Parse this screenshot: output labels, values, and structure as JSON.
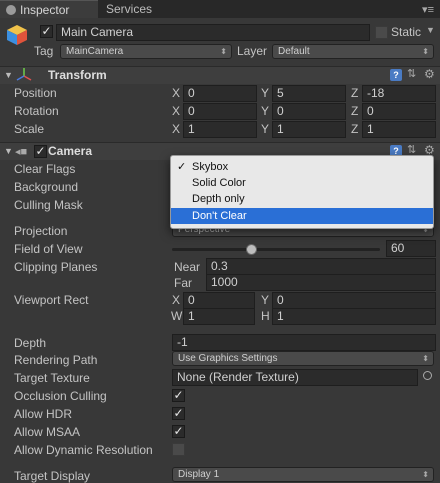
{
  "tabs": [
    {
      "label": "Inspector",
      "active": true
    },
    {
      "label": "Services",
      "active": false
    }
  ],
  "object": {
    "enabled": true,
    "name": "Main Camera",
    "static_label": "Static",
    "tag_label": "Tag",
    "tag_value": "MainCamera",
    "layer_label": "Layer",
    "layer_value": "Default"
  },
  "transform": {
    "title": "Transform",
    "position_label": "Position",
    "rotation_label": "Rotation",
    "scale_label": "Scale",
    "position": {
      "x": "0",
      "y": "5",
      "z": "-18"
    },
    "rotation": {
      "x": "0",
      "y": "0",
      "z": "0"
    },
    "scale": {
      "x": "1",
      "y": "1",
      "z": "1"
    }
  },
  "axes": {
    "x": "X",
    "y": "Y",
    "z": "Z",
    "w": "W",
    "h": "H"
  },
  "camera": {
    "title": "Camera",
    "enabled": true,
    "clear_flags_label": "Clear Flags",
    "background_label": "Background",
    "culling_mask_label": "Culling Mask",
    "projection_label": "Projection",
    "projection_value": "Perspective",
    "fov_label": "Field of View",
    "fov_value": "60",
    "fov_fraction": 0.38,
    "clipping_label": "Clipping Planes",
    "near_label": "Near",
    "near_value": "0.3",
    "far_label": "Far",
    "far_value": "1000",
    "viewport_label": "Viewport Rect",
    "viewport": {
      "x": "0",
      "y": "0",
      "w": "1",
      "h": "1"
    },
    "depth_label": "Depth",
    "depth_value": "-1",
    "rendering_path_label": "Rendering Path",
    "rendering_path_value": "Use Graphics Settings",
    "target_texture_label": "Target Texture",
    "target_texture_value": "None (Render Texture)",
    "occlusion_label": "Occlusion Culling",
    "occlusion": true,
    "hdr_label": "Allow HDR",
    "hdr": true,
    "msaa_label": "Allow MSAA",
    "msaa": true,
    "dynres_label": "Allow Dynamic Resolution",
    "dynres": false,
    "target_display_label": "Target Display",
    "target_display_value": "Display 1"
  },
  "popup": {
    "items": [
      {
        "label": "Skybox",
        "checked": true,
        "selected": false
      },
      {
        "label": "Solid Color",
        "checked": false,
        "selected": false
      },
      {
        "label": "Depth only",
        "checked": false,
        "selected": false
      },
      {
        "label": "Don't Clear",
        "checked": false,
        "selected": true
      }
    ]
  },
  "colors": {
    "accent": "#2a6fd6",
    "panel": "#383838"
  },
  "icons": [
    "gameobject-cube-icon",
    "transform-axes-icon",
    "camera-icon",
    "help-icon",
    "sliders-icon",
    "gear-icon",
    "menu-icon",
    "target-picker-icon"
  ]
}
